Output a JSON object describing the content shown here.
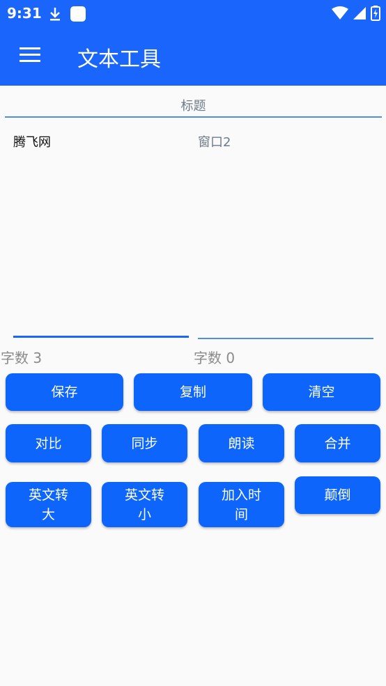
{
  "status_bar": {
    "time": "9:31"
  },
  "app_bar": {
    "title": "文本工具"
  },
  "title_field": {
    "placeholder": "标题"
  },
  "editor1": {
    "value": "腾飞网"
  },
  "editor2": {
    "value": "",
    "placeholder": "窗口2"
  },
  "counts": {
    "left": "字数  3",
    "right": "字数  0"
  },
  "buttons": {
    "save": "保存",
    "copy": "复制",
    "clear": "清空",
    "compare": "对比",
    "sync": "同步",
    "read_aloud": "朗读",
    "merge": "合并",
    "upper_line1": "英文转",
    "upper_line2": "大",
    "lower_line1": "英文转",
    "lower_line2": "小",
    "time_line1": "加入时",
    "time_line2": "间",
    "reverse": "颠倒"
  }
}
